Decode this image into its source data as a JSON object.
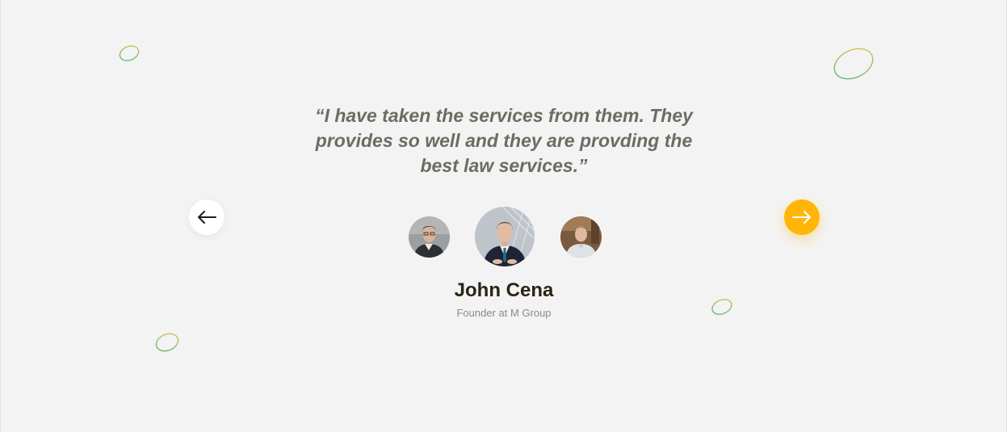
{
  "testimonial": {
    "quote": "“I have taken the services from them. They provides so well and they are provding the best law services.”",
    "name": "John Cena",
    "role": "Founder at M Group"
  },
  "navigation": {
    "prev_icon": "arrow-left-icon",
    "next_icon": "arrow-right-icon"
  },
  "avatars": [
    {
      "icon": "person-photo",
      "state": "inactive"
    },
    {
      "icon": "person-photo",
      "state": "active"
    },
    {
      "icon": "person-photo",
      "state": "inactive"
    }
  ],
  "colors": {
    "background": "#f3f3f3",
    "accent": "#ffb609",
    "quote_text": "#6e6b62",
    "name_text": "#2b2416",
    "role_text": "#8a8a8a",
    "deco_green": "#4fb58a",
    "deco_yellow": "#e8c24a"
  }
}
